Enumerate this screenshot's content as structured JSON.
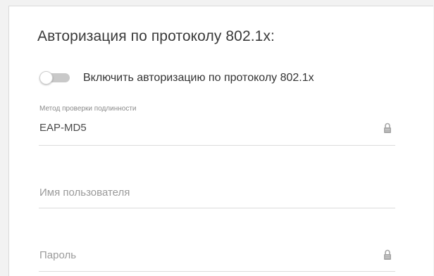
{
  "section": {
    "title": "Авторизация по протоколу 802.1x:"
  },
  "toggle": {
    "label": "Включить авторизацию по протоколу 802.1x",
    "enabled": false
  },
  "auth_method": {
    "label": "Метод проверки подлинности",
    "value": "EAP-MD5",
    "icon": "lock-icon"
  },
  "username": {
    "placeholder": "Имя пользователя",
    "value": ""
  },
  "password": {
    "placeholder": "Пароль",
    "value": "",
    "icon": "lock-icon"
  },
  "colors": {
    "background": "#f2f2f2",
    "panel": "#ffffff",
    "text": "#3a3a3a",
    "muted": "#9a9a9a",
    "line": "#dcdcdc",
    "toggle_off": "#c9c9c9"
  }
}
